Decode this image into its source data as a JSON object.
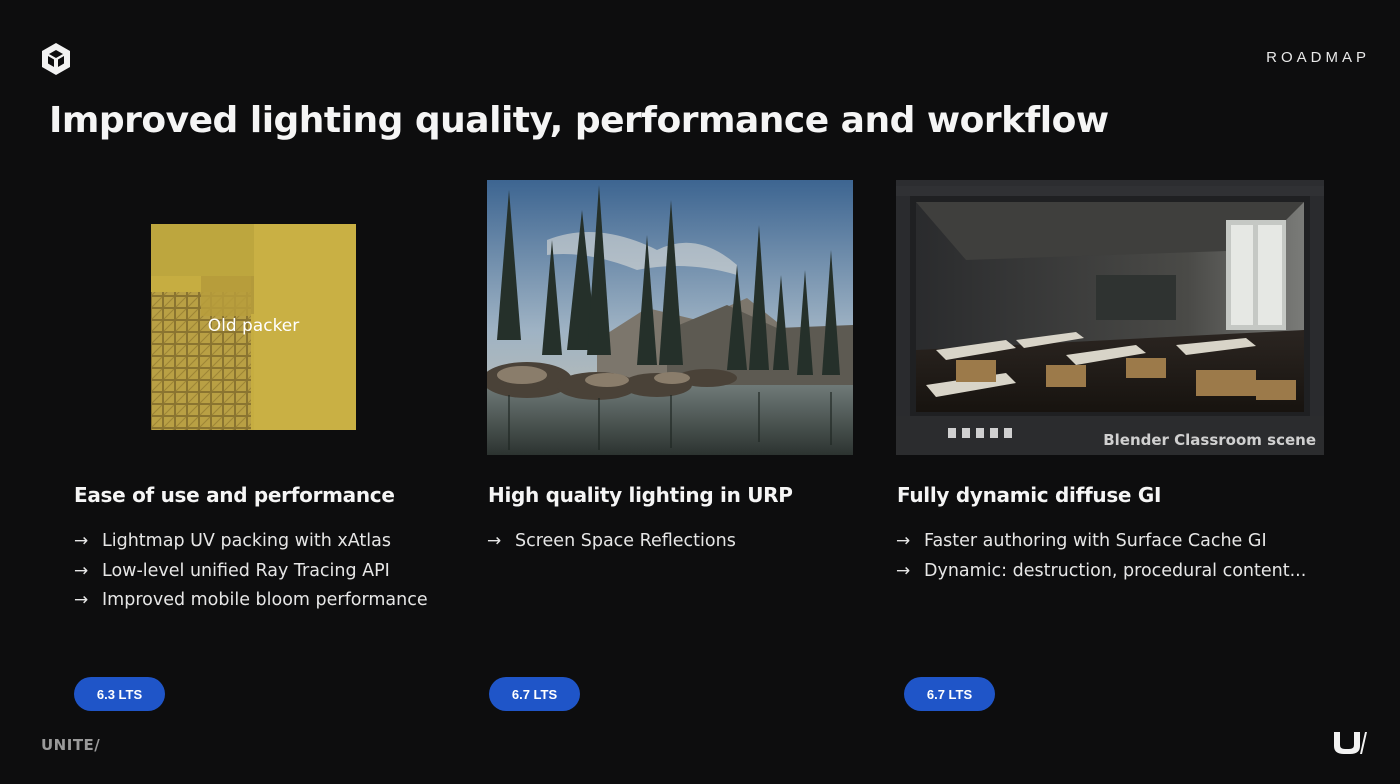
{
  "header": {
    "section_label": "ROADMAP",
    "title": "Improved lighting quality, performance and workflow"
  },
  "columns": [
    {
      "image_label": "Old packer",
      "heading": "Ease of use and performance",
      "bullets": [
        "Lightmap UV packing with xAtlas",
        "Low-level unified Ray Tracing API",
        "Improved mobile bloom performance"
      ],
      "badge": "6.3 LTS"
    },
    {
      "heading": "High quality lighting in URP",
      "bullets": [
        "Screen Space Reflections"
      ],
      "badge": "6.7 LTS"
    },
    {
      "image_caption": "Blender Classroom scene",
      "heading": "Fully dynamic diffuse GI",
      "bullets": [
        "Faster authoring with Surface Cache GI",
        "Dynamic: destruction, procedural content..."
      ],
      "badge": "6.7 LTS"
    }
  ],
  "footer": {
    "brand_text": "UNITE/"
  },
  "icons": {
    "logo": "unity-cube-icon",
    "bullet": "arrow-right-icon",
    "brand_mark": "unity-u-slash-icon"
  },
  "colors": {
    "background": "#0d0d0e",
    "badge": "#1f55c8",
    "packer": "#c6ad41"
  }
}
